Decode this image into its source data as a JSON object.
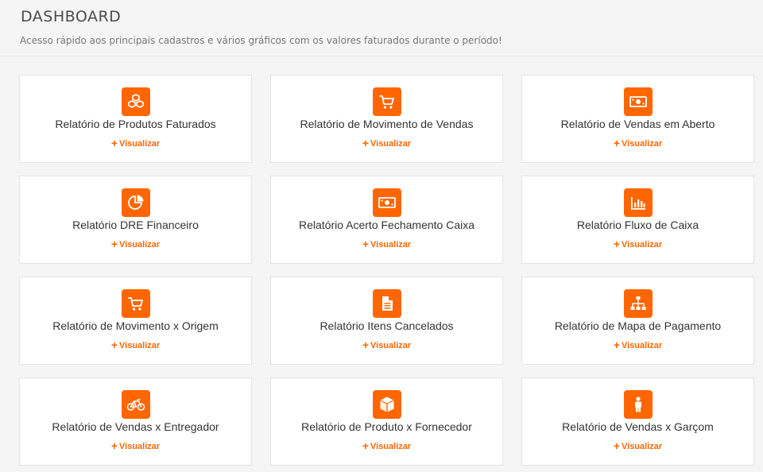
{
  "header": {
    "title": "DASHBOARD",
    "subtitle": "Acesso rápido aos principais cadastros e vários gráficos com os valores faturados durante o período!"
  },
  "accent_color": "#ff6600",
  "view_label": "Visualizar",
  "cards": [
    {
      "title": "Relatório de Produtos Faturados",
      "icon": "cubes-icon"
    },
    {
      "title": "Relatório de Movimento de Vendas",
      "icon": "shopping-cart-icon"
    },
    {
      "title": "Relatório de Vendas em Aberto",
      "icon": "money-icon"
    },
    {
      "title": "Relatório DRE Financeiro",
      "icon": "pie-chart-icon"
    },
    {
      "title": "Relatório Acerto Fechamento Caixa",
      "icon": "money-icon"
    },
    {
      "title": "Relatório Fluxo de Caixa",
      "icon": "bar-chart-icon"
    },
    {
      "title": "Relatório de Movimento x Origem",
      "icon": "shopping-cart-icon"
    },
    {
      "title": "Relatório Itens Cancelados",
      "icon": "file-text-icon"
    },
    {
      "title": "Relatório de Mapa de Pagamento",
      "icon": "sitemap-icon"
    },
    {
      "title": "Relatório de Vendas x Entregador",
      "icon": "bicycle-icon"
    },
    {
      "title": "Relatório de Produto x Fornecedor",
      "icon": "cube-icon"
    },
    {
      "title": "Relatório de Vendas x Garçom",
      "icon": "person-icon"
    }
  ]
}
